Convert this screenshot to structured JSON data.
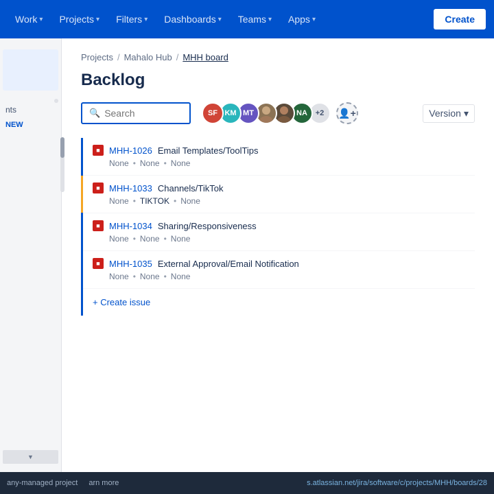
{
  "navbar": {
    "items": [
      {
        "label": "Work",
        "id": "work",
        "hasChevron": true
      },
      {
        "label": "Projects",
        "id": "projects",
        "hasChevron": true
      },
      {
        "label": "Filters",
        "id": "filters",
        "hasChevron": true
      },
      {
        "label": "Dashboards",
        "id": "dashboards",
        "hasChevron": true
      },
      {
        "label": "Teams",
        "id": "teams",
        "hasChevron": true
      },
      {
        "label": "Apps",
        "id": "apps",
        "hasChevron": true
      }
    ],
    "create_label": "Create"
  },
  "breadcrumb": {
    "projects": "Projects",
    "hub": "Mahalo Hub",
    "board": "MHH board",
    "sep": "/"
  },
  "page": {
    "title": "Backlog"
  },
  "toolbar": {
    "search_placeholder": "Search",
    "version_label": "Version",
    "avatars": [
      {
        "initials": "SF",
        "color": "#d04437",
        "title": "SF"
      },
      {
        "initials": "KM",
        "color": "#2ab6bc",
        "title": "KM"
      },
      {
        "initials": "MT",
        "color": "#6554c0",
        "title": "MT"
      },
      {
        "initials": "photo1",
        "color": "#8b7355",
        "title": "User"
      },
      {
        "initials": "photo2",
        "color": "#5a3e2b",
        "title": "User"
      },
      {
        "initials": "NA",
        "color": "#24663b",
        "title": "NA"
      },
      {
        "initials": "+2",
        "color": "#dfe1e6",
        "title": "2 more"
      }
    ]
  },
  "backlog_items": [
    {
      "id": "MHH-1026",
      "title": "Email Templates/ToolTips",
      "meta1": "None",
      "meta2": "None",
      "meta3": "None",
      "priority_color": "#0052cc"
    },
    {
      "id": "MHH-1033",
      "title": "Channels/TikTok",
      "meta1": "None",
      "meta2": "TIKTOK",
      "meta3": "None",
      "priority_color": "#f5a623"
    },
    {
      "id": "MHH-1034",
      "title": "Sharing/Responsiveness",
      "meta1": "None",
      "meta2": "None",
      "meta3": "None",
      "priority_color": "#0052cc"
    },
    {
      "id": "MHH-1035",
      "title": "External Approval/Email Notification",
      "meta1": "None",
      "meta2": "None",
      "meta3": "None",
      "priority_color": "#0052cc"
    }
  ],
  "sidebar": {
    "label_new": "NEW",
    "items": [
      "nts"
    ]
  },
  "create_issue_label": "+ Create issue",
  "bottom": {
    "managed": "any-managed project",
    "learn": "arn more",
    "url": "s.atlassian.net/jira/software/c/projects/MHH/boards/28"
  }
}
